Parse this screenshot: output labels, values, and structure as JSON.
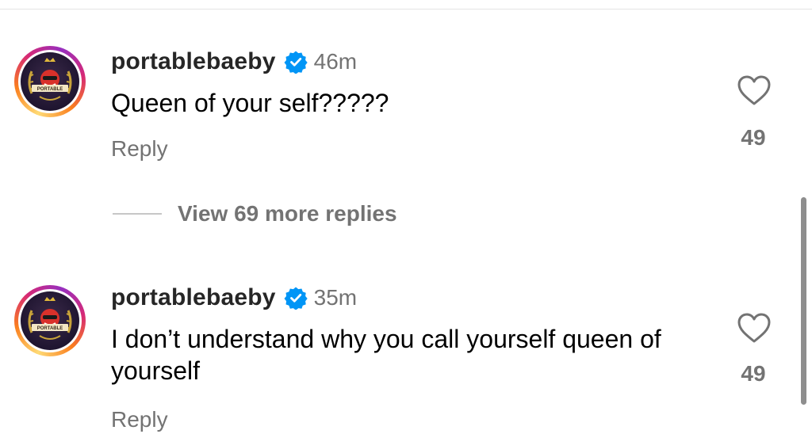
{
  "comments": [
    {
      "username": "portablebaeby",
      "verified_icon": "verified-badge-icon",
      "timestamp": "46m",
      "text": "Queen of your self?????",
      "reply_label": "Reply",
      "like_icon": "heart-outline-icon",
      "likes": "49",
      "avatar_label": "PORTABLE"
    },
    {
      "username": "portablebaeby",
      "verified_icon": "verified-badge-icon",
      "timestamp": "35m",
      "text": "I don’t understand why you call yourself queen of yourself",
      "reply_label": "Reply",
      "like_icon": "heart-outline-icon",
      "likes": "49",
      "avatar_label": "PORTABLE"
    }
  ],
  "view_replies": {
    "label": "View 69 more replies"
  },
  "colors": {
    "verified_blue": "#0095f6",
    "secondary_text": "#737373",
    "primary_text": "#000000",
    "story_ring": [
      "#feda75",
      "#fa7e1e",
      "#d62976",
      "#962fbf"
    ]
  }
}
